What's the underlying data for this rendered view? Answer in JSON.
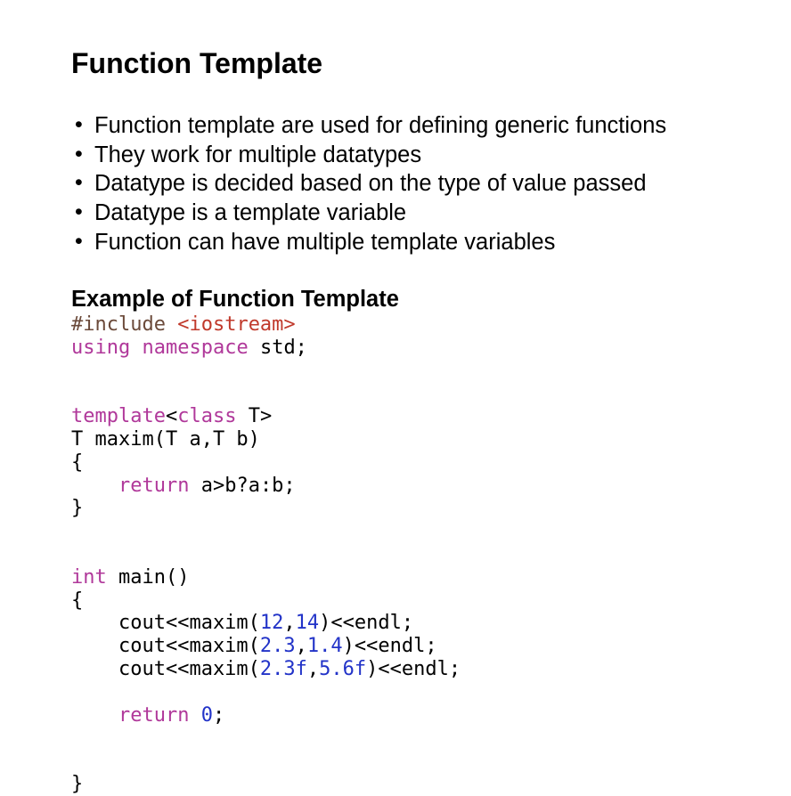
{
  "title": "Function Template",
  "bullets": [
    "Function template are used for defining generic functions",
    "They work for multiple datatypes",
    "Datatype is decided based on the type of value passed",
    "Datatype is a template variable",
    "Function can have multiple template variables"
  ],
  "example_title": "Example of Function Template",
  "colors": {
    "plain": "#000000",
    "preproc": "#6b4a3a",
    "string": "#c0392b",
    "keyword": "#b0389a",
    "number": "#2233c8"
  },
  "code_lines": [
    [
      [
        "preproc",
        "#include "
      ],
      [
        "string",
        "<iostream>"
      ]
    ],
    [
      [
        "keyword",
        "using"
      ],
      [
        "plain",
        " "
      ],
      [
        "keyword",
        "namespace"
      ],
      [
        "plain",
        " std;"
      ]
    ],
    [],
    [],
    [
      [
        "keyword",
        "template"
      ],
      [
        "plain",
        "<"
      ],
      [
        "keyword",
        "class"
      ],
      [
        "plain",
        " T>"
      ]
    ],
    [
      [
        "plain",
        "T maxim(T a,T b)"
      ]
    ],
    [
      [
        "plain",
        "{"
      ]
    ],
    [
      [
        "plain",
        "    "
      ],
      [
        "keyword",
        "return"
      ],
      [
        "plain",
        " a>b?a:b;"
      ]
    ],
    [
      [
        "plain",
        "}"
      ]
    ],
    [],
    [],
    [
      [
        "keyword",
        "int"
      ],
      [
        "plain",
        " main()"
      ]
    ],
    [
      [
        "plain",
        "{"
      ]
    ],
    [
      [
        "plain",
        "    cout<<maxim("
      ],
      [
        "number",
        "12"
      ],
      [
        "plain",
        ","
      ],
      [
        "number",
        "14"
      ],
      [
        "plain",
        ")<<endl;"
      ]
    ],
    [
      [
        "plain",
        "    cout<<maxim("
      ],
      [
        "number",
        "2.3"
      ],
      [
        "plain",
        ","
      ],
      [
        "number",
        "1.4"
      ],
      [
        "plain",
        ")<<endl;"
      ]
    ],
    [
      [
        "plain",
        "    cout<<maxim("
      ],
      [
        "number",
        "2.3f"
      ],
      [
        "plain",
        ","
      ],
      [
        "number",
        "5.6f"
      ],
      [
        "plain",
        ")<<endl;"
      ]
    ],
    [],
    [
      [
        "plain",
        "    "
      ],
      [
        "keyword",
        "return"
      ],
      [
        "plain",
        " "
      ],
      [
        "number",
        "0"
      ],
      [
        "plain",
        ";"
      ]
    ],
    [],
    [],
    [
      [
        "plain",
        "}"
      ]
    ]
  ]
}
